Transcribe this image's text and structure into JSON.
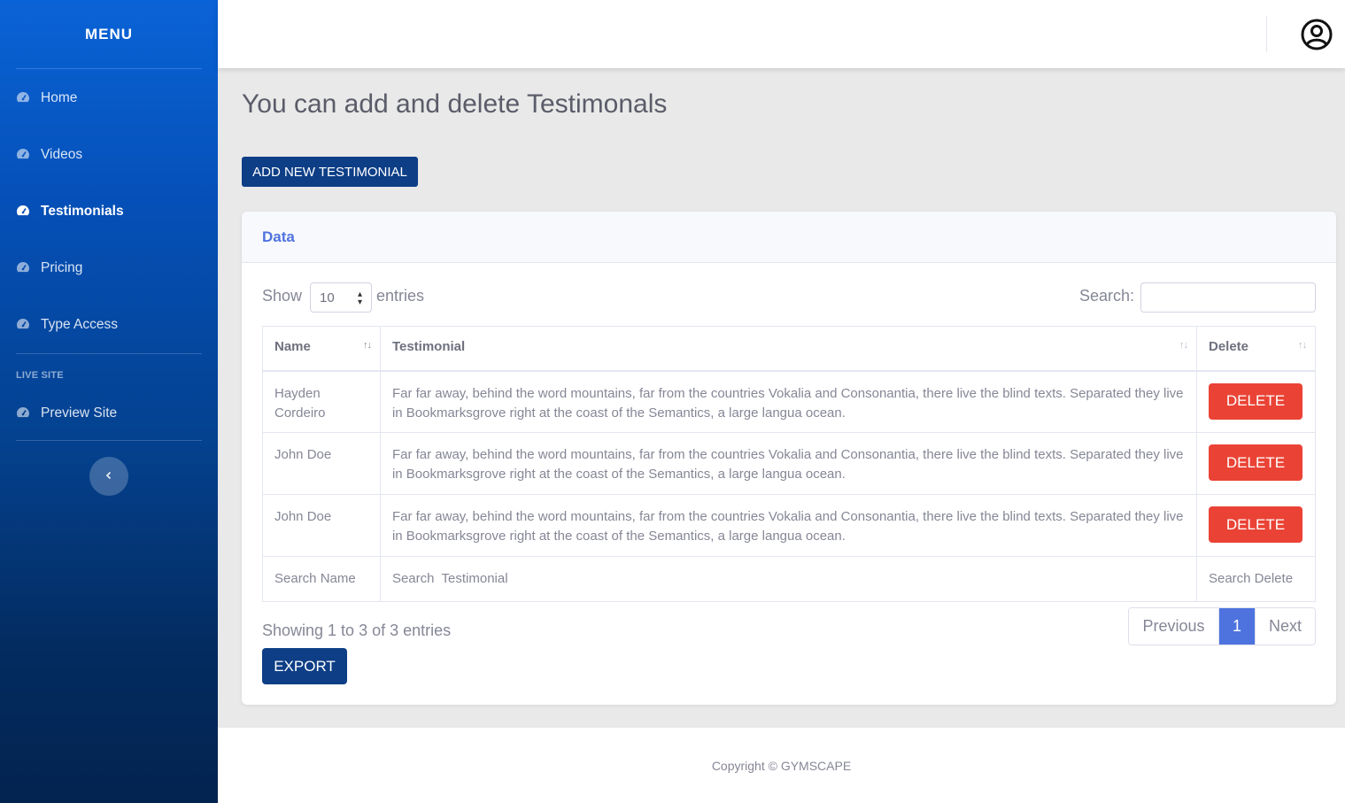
{
  "sidebar": {
    "brand": "MENU",
    "items": [
      {
        "label": "Home",
        "icon": "tachometer-icon"
      },
      {
        "label": "Videos",
        "icon": "tachometer-icon"
      },
      {
        "label": "Testimonials",
        "icon": "tachometer-icon",
        "active": true
      },
      {
        "label": "Pricing",
        "icon": "tachometer-icon"
      },
      {
        "label": "Type Access",
        "icon": "tachometer-icon"
      }
    ],
    "heading": "LIVE SITE",
    "preview": {
      "label": "Preview Site",
      "icon": "tachometer-icon"
    },
    "toggle_icon": "chevron-left-icon",
    "gradient": [
      "#0a63d6",
      "#03234f"
    ]
  },
  "topbar": {
    "user_icon": "user-circle-icon"
  },
  "main": {
    "title": "You can add and delete Testimonals",
    "add_button": "ADD NEW TESTIMONIAL"
  },
  "card": {
    "title": "Data",
    "show_label": "Show",
    "length_value": "10",
    "entries_label": "entries",
    "search_label": "Search:",
    "search_value": "",
    "columns": [
      "Name",
      "Testimonial",
      "Delete"
    ],
    "rows": [
      {
        "name": "Hayden Cordeiro",
        "testimonial": "Far far away, behind the word mountains, far from the countries Vokalia and Consonantia, there live the blind texts. Separated they live in Bookmarksgrove right at the coast of the Semantics, a large langua ocean.",
        "action": "DELETE"
      },
      {
        "name": "John Doe",
        "testimonial": "Far far away, behind the word mountains, far from the countries Vokalia and Consonantia, there live the blind texts. Separated they live in Bookmarksgrove right at the coast of the Semantics, a large langua ocean.",
        "action": "DELETE"
      },
      {
        "name": "John Doe",
        "testimonial": "Far far away, behind the word mountains, far from the countries Vokalia and Consonantia, there live the blind texts. Separated they live in Bookmarksgrove right at the coast of the Semantics, a large langua ocean.",
        "action": "DELETE"
      }
    ],
    "footer_filters": [
      "Search Name",
      "Search  Testimonial",
      "Search Delete"
    ],
    "info": "Showing 1 to 3 of 3 entries",
    "pagination": {
      "previous": "Previous",
      "current": "1",
      "next": "Next"
    },
    "export_button": "EXPORT"
  },
  "footer": {
    "copyright": "Copyright © GYMSCAPE"
  },
  "colors": {
    "primary_dark": "#0d3e86",
    "accent": "#4e73df",
    "danger": "#ea4335"
  }
}
